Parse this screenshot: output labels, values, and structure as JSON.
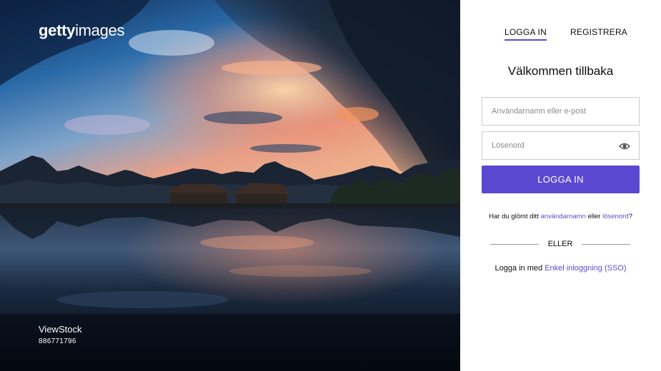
{
  "hero": {
    "logo_bold": "getty",
    "logo_light": "images",
    "credit_artist": "ViewStock",
    "credit_image_id": "886771796"
  },
  "tabs": {
    "login_label": "LOGGA IN",
    "register_label": "REGISTRERA"
  },
  "form": {
    "title": "Välkommen tillbaka",
    "username_placeholder": "Användarnamn eller e-post",
    "password_placeholder": "Lösenord",
    "submit_label": "LOGGA IN"
  },
  "forgot": {
    "prefix": "Har du glömt ditt ",
    "username_link": "användarnamn",
    "middle": " eller ",
    "password_link": "lösenord",
    "suffix": "?"
  },
  "divider_label": "ELLER",
  "sso": {
    "prefix": "Logga in med ",
    "link": "Enkel inloggning (SSO)"
  },
  "colors": {
    "accent": "#5b48d0",
    "link": "#5c4ad0"
  }
}
